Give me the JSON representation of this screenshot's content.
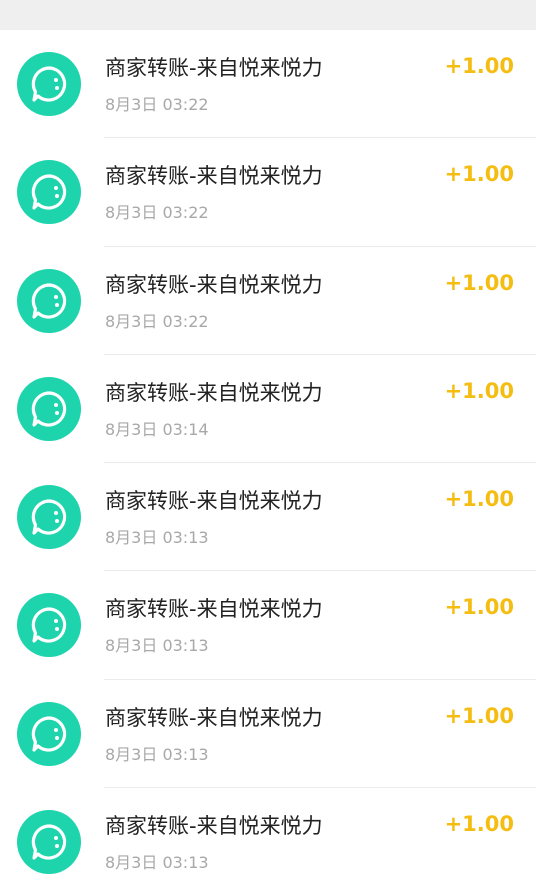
{
  "header": {
    "partial_text": ""
  },
  "colors": {
    "avatar_bg": "#1ed4ac",
    "amount": "#f5bd12",
    "title": "#222222",
    "time": "#a8a8a8"
  },
  "transactions": [
    {
      "title": "商家转账-来自悦来悦力",
      "time": "8月3日 03:22",
      "amount": "+1.00",
      "icon": "chat-bubble-icon"
    },
    {
      "title": "商家转账-来自悦来悦力",
      "time": "8月3日 03:22",
      "amount": "+1.00",
      "icon": "chat-bubble-icon"
    },
    {
      "title": "商家转账-来自悦来悦力",
      "time": "8月3日 03:22",
      "amount": "+1.00",
      "icon": "chat-bubble-icon"
    },
    {
      "title": "商家转账-来自悦来悦力",
      "time": "8月3日 03:14",
      "amount": "+1.00",
      "icon": "chat-bubble-icon"
    },
    {
      "title": "商家转账-来自悦来悦力",
      "time": "8月3日 03:13",
      "amount": "+1.00",
      "icon": "chat-bubble-icon"
    },
    {
      "title": "商家转账-来自悦来悦力",
      "time": "8月3日 03:13",
      "amount": "+1.00",
      "icon": "chat-bubble-icon"
    },
    {
      "title": "商家转账-来自悦来悦力",
      "time": "8月3日 03:13",
      "amount": "+1.00",
      "icon": "chat-bubble-icon"
    },
    {
      "title": "商家转账-来自悦来悦力",
      "time": "8月3日 03:13",
      "amount": "+1.00",
      "icon": "chat-bubble-icon"
    }
  ]
}
